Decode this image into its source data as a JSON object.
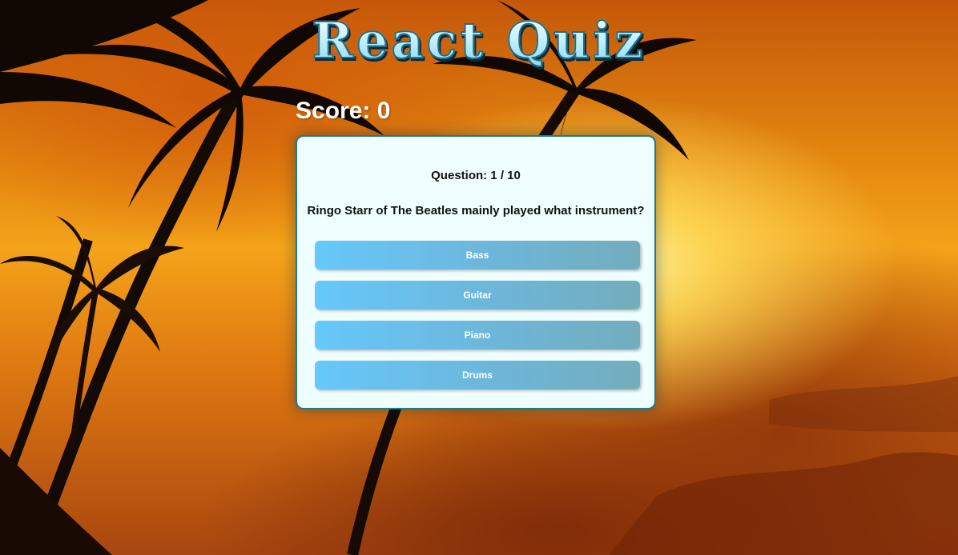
{
  "header": {
    "title": "React Quiz"
  },
  "score": {
    "text": "Score: 0"
  },
  "question": {
    "number_text": "Question: 1 / 10",
    "text": "Ringo Starr of The Beatles mainly played what instrument?"
  },
  "answers": [
    {
      "label": "Bass"
    },
    {
      "label": "Guitar"
    },
    {
      "label": "Piano"
    },
    {
      "label": "Drums"
    }
  ],
  "colors": {
    "button_start": "#66c8fb",
    "button_end": "#73adbc",
    "card_background": "#effeff",
    "card_border": "#1f7a90"
  }
}
